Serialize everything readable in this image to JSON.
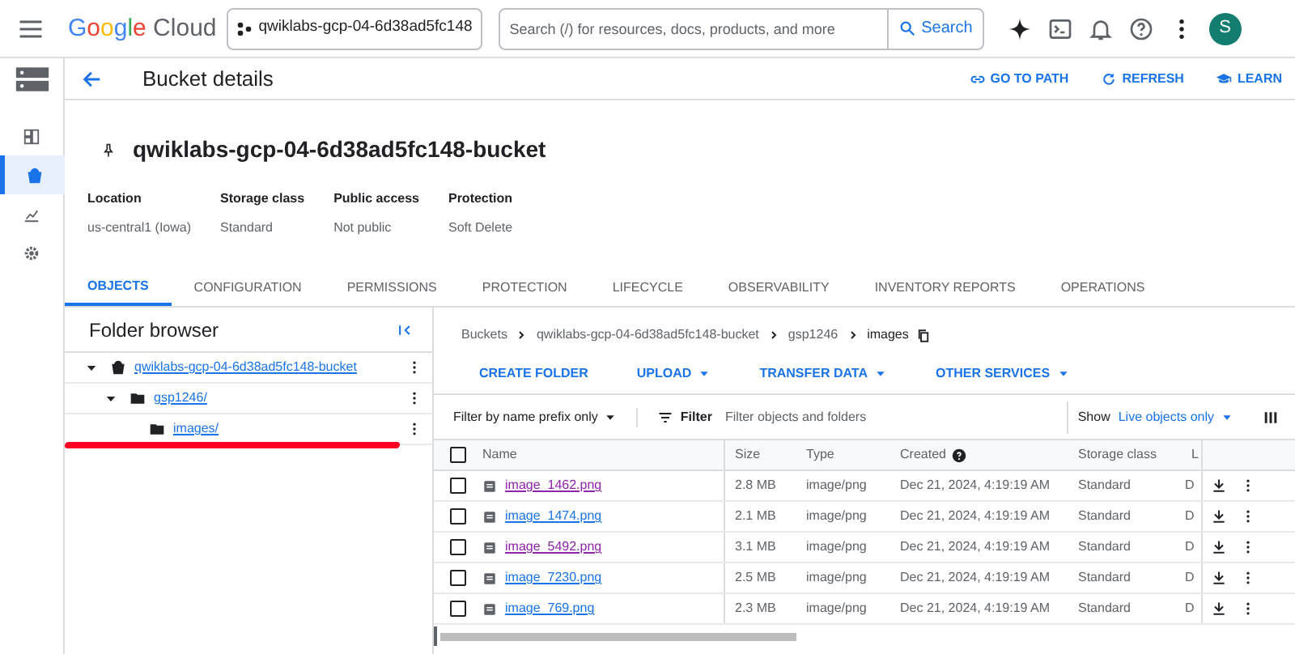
{
  "topbar": {
    "logo": "Google Cloud",
    "project": "qwiklabs-gcp-04-6d38ad5fc148",
    "search": {
      "placeholder": "Search (/) for resources, docs, products, and more"
    },
    "search_button": "Search",
    "avatar": "S"
  },
  "rail": [
    {
      "selected": false
    },
    {
      "selected": true
    },
    {
      "selected": false
    },
    {
      "selected": false
    }
  ],
  "header": {
    "title": "Bucket details",
    "actions": [
      "GO TO PATH",
      "REFRESH",
      "LEARN"
    ]
  },
  "bucket": {
    "name": "qwiklabs-gcp-04-6d38ad5fc148-bucket",
    "props": [
      {
        "label": "Location",
        "value": "us-central1 (Iowa)"
      },
      {
        "label": "Storage class",
        "value": "Standard"
      },
      {
        "label": "Public access",
        "value": "Not public"
      },
      {
        "label": "Protection",
        "value": "Soft Delete"
      }
    ]
  },
  "tabs": [
    {
      "label": "OBJECTS",
      "selected": true
    },
    {
      "label": "CONFIGURATION",
      "selected": false
    },
    {
      "label": "PERMISSIONS",
      "selected": false
    },
    {
      "label": "PROTECTION",
      "selected": false
    },
    {
      "label": "LIFECYCLE",
      "selected": false
    },
    {
      "label": "OBSERVABILITY",
      "selected": false
    },
    {
      "label": "INVENTORY REPORTS",
      "selected": false
    },
    {
      "label": "OPERATIONS",
      "selected": false
    }
  ],
  "folder_browser": {
    "title": "Folder browser",
    "tree": [
      {
        "label": "qwiklabs-gcp-04-6d38ad5fc148-bucket",
        "kind": "bucket",
        "expanded": true,
        "children": [
          {
            "label": "gsp1246/",
            "kind": "folder",
            "expanded": true,
            "children": [
              {
                "label": "images/",
                "kind": "folder"
              }
            ]
          }
        ]
      }
    ]
  },
  "breadcrumbs": [
    "Buckets",
    "qwiklabs-gcp-04-6d38ad5fc148-bucket",
    "gsp1246",
    "images"
  ],
  "actions": [
    {
      "label": "CREATE FOLDER",
      "dropdown": false
    },
    {
      "label": "UPLOAD",
      "dropdown": true
    },
    {
      "label": "TRANSFER DATA",
      "dropdown": true
    },
    {
      "label": "OTHER SERVICES",
      "dropdown": true
    }
  ],
  "filter": {
    "mode": "Filter by name prefix only",
    "label": "Filter",
    "placeholder": "Filter objects and folders",
    "show_label": "Show",
    "show_value": "Live objects only"
  },
  "table": {
    "select_all_checked": false,
    "columns": [
      "Name",
      "Size",
      "Type",
      "Created",
      "Storage class",
      "L"
    ],
    "rows": [
      {
        "name": "image_1462.png",
        "size": "2.8 MB",
        "type": "image/png",
        "created": "Dec 21, 2024, 4:19:19 AM",
        "storage": "Standard",
        "column_6": "D",
        "visited": true,
        "checked": false
      },
      {
        "name": "image_1474.png",
        "size": "2.1 MB",
        "type": "image/png",
        "created": "Dec 21, 2024, 4:19:19 AM",
        "storage": "Standard",
        "column_6": "D",
        "visited": false,
        "checked": false
      },
      {
        "name": "image_5492.png",
        "size": "3.1 MB",
        "type": "image/png",
        "created": "Dec 21, 2024, 4:19:19 AM",
        "storage": "Standard",
        "column_6": "D",
        "visited": true,
        "checked": false
      },
      {
        "name": "image_7230.png",
        "size": "2.5 MB",
        "type": "image/png",
        "created": "Dec 21, 2024, 4:19:19 AM",
        "storage": "Standard",
        "column_6": "D",
        "visited": false,
        "checked": false
      },
      {
        "name": "image_769.png",
        "size": "2.3 MB",
        "type": "image/png",
        "created": "Dec 21, 2024, 4:19:19 AM",
        "storage": "Standard",
        "column_6": "D",
        "visited": false,
        "checked": false
      }
    ]
  }
}
